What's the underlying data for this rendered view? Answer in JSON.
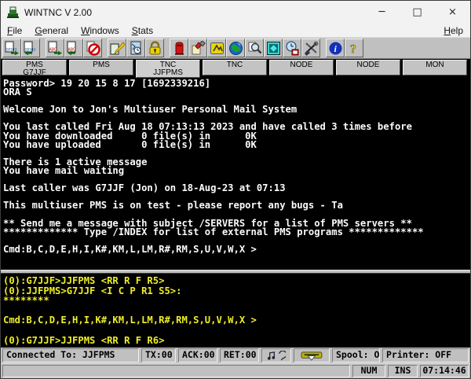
{
  "window": {
    "title": "WINTNC V 2.00",
    "controls": {
      "minimize": "─",
      "maximize": "□",
      "close": "×"
    }
  },
  "menu": {
    "items": [
      "File",
      "General",
      "Windows",
      "Stats"
    ],
    "help": "Help"
  },
  "toolbar": {
    "buttons": [
      "send-binary-file",
      "receive-binary-file",
      "send-text-file",
      "receive-text-file",
      "abort-transfer",
      "editor",
      "clipboard-clock",
      "password-lock",
      "mailbox",
      "flashlight-log",
      "warning-sign",
      "world-globe",
      "search-magnifier",
      "node-view",
      "clock-calendar",
      "tools",
      "info",
      "help-question"
    ]
  },
  "tabs": [
    {
      "line1": "PMS",
      "line2": "G7JJF"
    },
    {
      "line1": "PMS",
      "line2": ""
    },
    {
      "line1": "TNC",
      "line2": "JJFPMS"
    },
    {
      "line1": "TNC",
      "line2": ""
    },
    {
      "line1": "NODE",
      "line2": ""
    },
    {
      "line1": "NODE",
      "line2": ""
    },
    {
      "line1": "MON",
      "line2": ""
    }
  ],
  "terminal": {
    "lines": [
      "Password> 19 20 15 8 17 [1692339216]",
      "ORA S",
      "",
      "Welcome Jon to Jon's Multiuser Personal Mail System",
      "",
      "You last called Fri Aug 18 07:13:13 2023 and have called 3 times before",
      "You have downloaded     0 file(s) in      0K",
      "You have uploaded       0 file(s) in      0K",
      "",
      "There is 1 active message",
      "You have mail waiting",
      "",
      "Last caller was G7JJF (Jon) on 18-Aug-23 at 07:13",
      "",
      "This multiuser PMS is on test - please report any bugs - Ta",
      "",
      "** Send me a message with subject /SERVERS for a list of PMS servers **",
      "************* Type /INDEX for list of external PMS programs *************",
      "",
      "Cmd:B,C,D,E,H,I,K#,KM,L,LM,R#,RM,S,U,V,W,X >",
      "",
      "_"
    ]
  },
  "monitor": {
    "lines": [
      "(0):G7JJF>JJFPMS <RR R F R5>",
      "(0):JJFPMS>G7JJF <I C P R1 S5>:",
      "********",
      "",
      "Cmd:B,C,D,E,H,I,K#,KM,L,LM,R#,RM,S,U,V,W,X >",
      "",
      "(0):G7JJF>JJFPMS <RR R F R6>"
    ]
  },
  "statusbar": {
    "connected": "Connected To: JJFPMS",
    "tx": "TX:00",
    "ack": "ACK:00",
    "ret": "RET:00",
    "spool": "Spool: OFF",
    "printer": "Printer: OFF",
    "num": "NUM",
    "ins": "INS",
    "time": "07:14:46"
  }
}
